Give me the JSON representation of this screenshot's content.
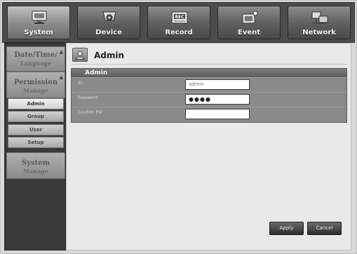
{
  "tabs": [
    {
      "label": "System",
      "icon": "monitor-icon",
      "active": true
    },
    {
      "label": "Device",
      "icon": "camera-icon",
      "active": false
    },
    {
      "label": "Record",
      "icon": "record-icon",
      "active": false
    },
    {
      "label": "Event",
      "icon": "event-icon",
      "active": false
    },
    {
      "label": "Network",
      "icon": "network-icon",
      "active": false
    }
  ],
  "sidebar": {
    "groups": [
      {
        "title": "Date/Time/",
        "subtitle": "Language",
        "mark": "▲"
      },
      {
        "title": "Permission",
        "subtitle": "Manage",
        "mark": "▲"
      },
      {
        "title": "System",
        "subtitle": "Manage"
      }
    ],
    "permission_items": [
      "Admin",
      "Group",
      "User",
      "Setup"
    ],
    "active_item": "Admin"
  },
  "page": {
    "title": "Admin",
    "section_title": "Admin",
    "fields": [
      {
        "label": "ID",
        "value": "admin"
      },
      {
        "label": "Password",
        "value": "●●●●"
      },
      {
        "label": "Confirm PW",
        "value": ""
      }
    ]
  },
  "buttons": {
    "apply": "Apply",
    "cancel": "Cancel"
  },
  "colors": {
    "topbar": "#4c4c4c",
    "sidebar": "#3a3a3a",
    "panel": "#e9e9e9",
    "section": "#8a8a8a"
  }
}
